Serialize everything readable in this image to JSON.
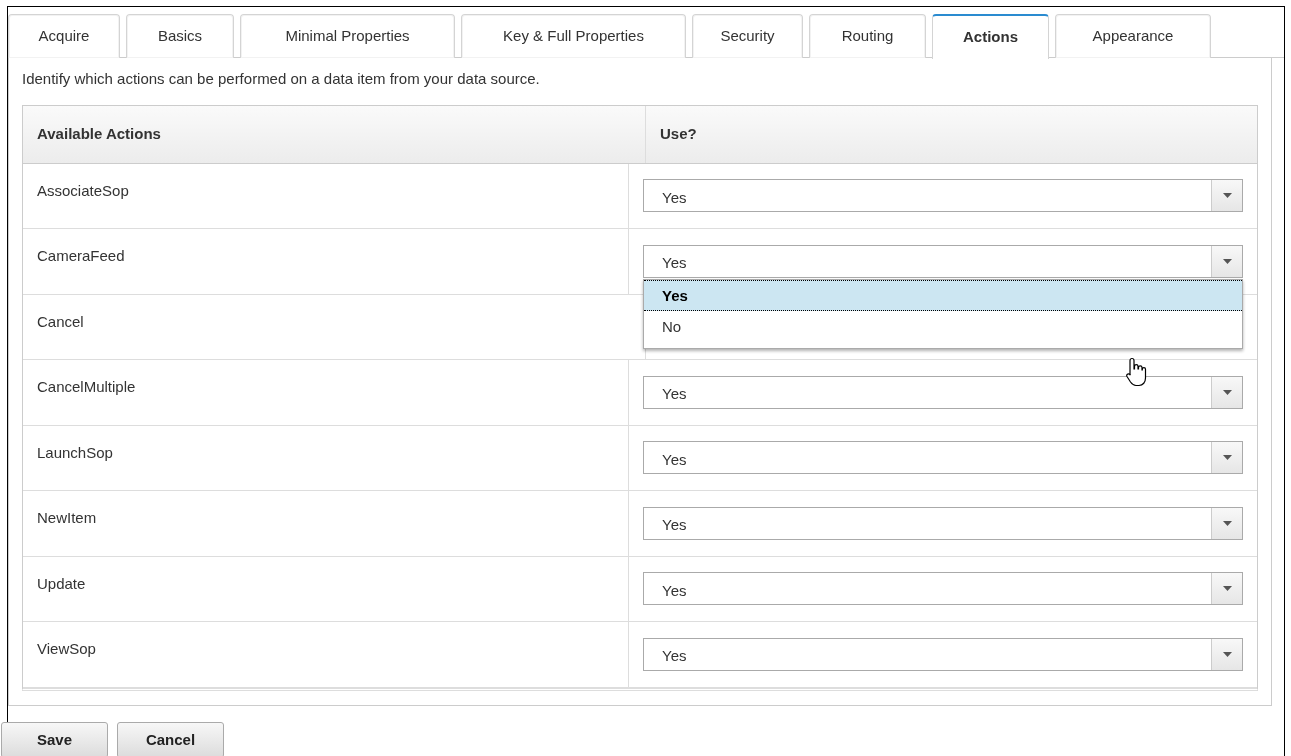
{
  "tabs": [
    {
      "label": "Acquire",
      "selected": false
    },
    {
      "label": "Basics",
      "selected": false
    },
    {
      "label": "Minimal Properties",
      "selected": false
    },
    {
      "label": "Key & Full Properties",
      "selected": false
    },
    {
      "label": "Security",
      "selected": false
    },
    {
      "label": "Routing",
      "selected": false
    },
    {
      "label": "Actions",
      "selected": true
    },
    {
      "label": "Appearance",
      "selected": false
    }
  ],
  "description": "Identify which actions can be performed on a data item from your data source.",
  "table": {
    "columns": [
      "Available Actions",
      "Use?"
    ],
    "rows": [
      {
        "action": "AssociateSop",
        "value": "Yes"
      },
      {
        "action": "CameraFeed",
        "value": "Yes",
        "expanded": true,
        "options": [
          {
            "label": "Yes",
            "selected": true
          },
          {
            "label": "No",
            "selected": false
          }
        ]
      },
      {
        "action": "Cancel"
      },
      {
        "action": "CancelMultiple",
        "value": "Yes"
      },
      {
        "action": "LaunchSop",
        "value": "Yes"
      },
      {
        "action": "NewItem",
        "value": "Yes"
      },
      {
        "action": "Update",
        "value": "Yes"
      },
      {
        "action": "ViewSop",
        "value": "Yes"
      }
    ]
  },
  "buttons": [
    "Save",
    "Cancel"
  ]
}
